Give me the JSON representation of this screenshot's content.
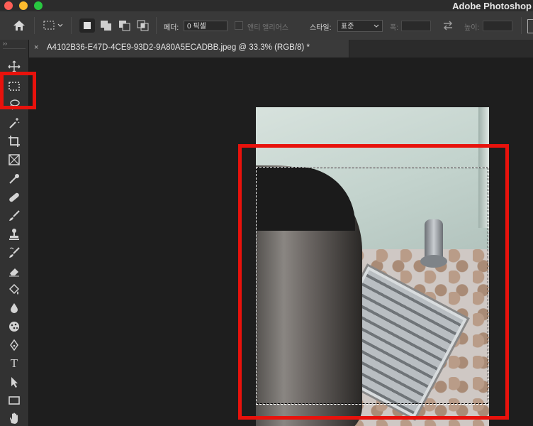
{
  "window": {
    "app_title": "Adobe Photoshop",
    "traffic_colors": [
      "#fe5f57",
      "#febc2e",
      "#28c840"
    ]
  },
  "options_bar": {
    "feather_label": "페더:",
    "feather_value": "0 픽셀",
    "antialias_label": "앤티 앨리어스",
    "style_label": "스타일:",
    "style_value": "표준",
    "width_label": "폭:",
    "height_label": "높이:"
  },
  "document_tab": {
    "close_glyph": "×",
    "title": "A4102B36-E47D-4CE9-93D2-9A80A5ECADBB.jpeg @ 33.3% (RGB/8) *"
  },
  "toolbar": {
    "collapse_glyph": "››",
    "tools": [
      "move-tool",
      "rectangular-marquee-tool",
      "lasso-tool",
      "magic-wand-tool",
      "crop-tool",
      "frame-tool",
      "eyedropper-tool",
      "healing-brush-tool",
      "brush-tool",
      "clone-stamp-tool",
      "history-brush-tool",
      "eraser-tool",
      "paint-bucket-tool",
      "blur-tool",
      "dodge-tool",
      "pen-tool",
      "type-tool",
      "path-selection-tool",
      "rectangle-tool",
      "hand-tool"
    ],
    "type_glyph": "T"
  },
  "highlight_color": "#e8120c"
}
